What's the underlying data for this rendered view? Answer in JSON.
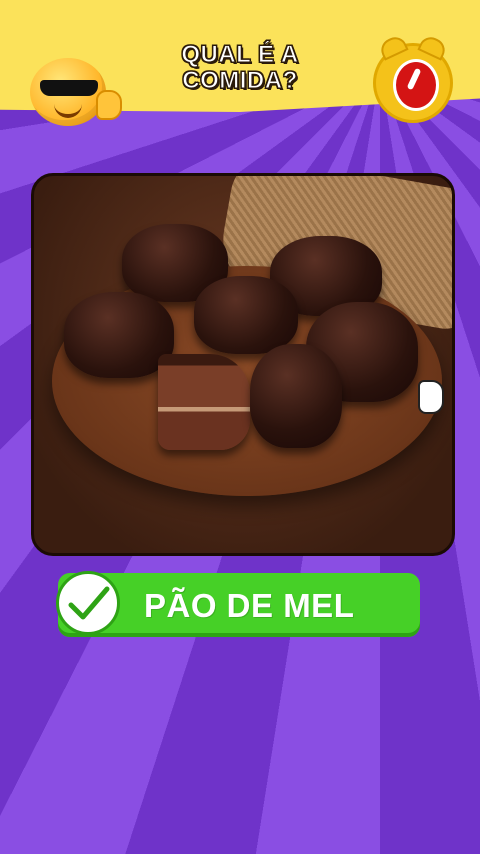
{
  "header": {
    "title": "QUAL É A\nCOMIDA?"
  },
  "icons": {
    "left": "cool-sunglasses-emoji-icon",
    "right": "alarm-clock-icon",
    "pointer": "cartoon-glove-hand-icon",
    "answer": "check-mark-icon"
  },
  "answer": {
    "label": "PÃO DE MEL"
  },
  "colors": {
    "header": "#fbe25a",
    "background": "#7b3fd6",
    "answer": "#46d027"
  }
}
